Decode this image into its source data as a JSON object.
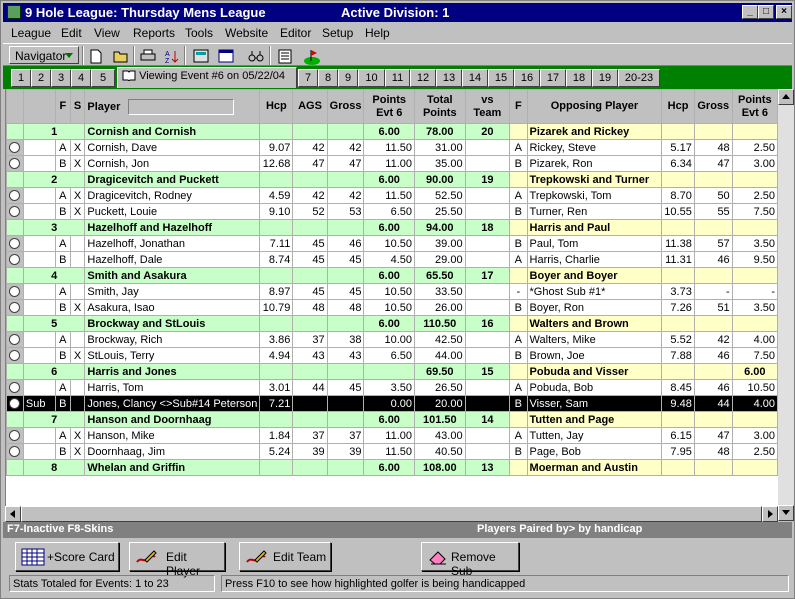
{
  "window": {
    "title": "9 Hole League: Thursday Mens League",
    "division": "Active Division: 1",
    "minimize_glyph": "_",
    "maximize_glyph": "□",
    "close_glyph": "×"
  },
  "menu": [
    "League",
    "Edit",
    "View",
    "Reports",
    "Tools",
    "Website",
    "Editor",
    "Setup",
    "Help"
  ],
  "toolbar": {
    "navigator_label": "Navigator"
  },
  "tabs": {
    "before": [
      "1",
      "2",
      "3",
      "4",
      "5"
    ],
    "active": "Viewing Event #6 on 05/22/04",
    "after": [
      "7",
      "8",
      "9",
      "10",
      "11",
      "12",
      "13",
      "14",
      "15",
      "16",
      "17",
      "18",
      "19",
      "20-23"
    ]
  },
  "grid": {
    "headers": {
      "f": "F",
      "s": "S",
      "player": "Player",
      "hcp": "Hcp",
      "ags": "AGS",
      "gross": "Gross",
      "points_evt_1": "Points",
      "points_evt_2": "Evt 6",
      "total_1": "Total",
      "total_2": "Points",
      "vs_1": "vs",
      "vs_2": "Team",
      "f2": "F",
      "opp_player": "Opposing Player",
      "opp_hcp": "Hcp",
      "opp_gross": "Gross",
      "opp_points_1": "Points",
      "opp_points_2": "Evt 6"
    },
    "teams": [
      {
        "num": "1",
        "name": "Cornish and Cornish",
        "points": "6.00",
        "total": "78.00",
        "vs": "20",
        "opp_name": "Pizarek and Rickey",
        "opp_points": "",
        "players": [
          {
            "sub": "",
            "f": "A",
            "s": "X",
            "name": "Cornish, Dave",
            "hcp": "9.07",
            "ags": "42",
            "gross": "42",
            "pts": "11.50",
            "tot": "31.00",
            "of": "A",
            "oname": "Rickey, Steve",
            "ohcp": "5.17",
            "ogross": "48",
            "opts": "2.50"
          },
          {
            "sub": "",
            "f": "B",
            "s": "X",
            "name": "Cornish, Jon",
            "hcp": "12.68",
            "ags": "47",
            "gross": "47",
            "pts": "11.00",
            "tot": "35.00",
            "of": "B",
            "oname": "Pizarek, Ron",
            "ohcp": "6.34",
            "ogross": "47",
            "opts": "3.00"
          }
        ]
      },
      {
        "num": "2",
        "name": "Dragicevitch and Puckett",
        "points": "6.00",
        "total": "90.00",
        "vs": "19",
        "opp_name": "Trepkowski and Turner",
        "opp_points": "",
        "players": [
          {
            "sub": "",
            "f": "A",
            "s": "X",
            "name": "Dragicevitch, Rodney",
            "hcp": "4.59",
            "ags": "42",
            "gross": "42",
            "pts": "11.50",
            "tot": "52.50",
            "of": "A",
            "oname": "Trepkowski, Tom",
            "ohcp": "8.70",
            "ogross": "50",
            "opts": "2.50"
          },
          {
            "sub": "",
            "f": "B",
            "s": "X",
            "name": "Puckett, Louie",
            "hcp": "9.10",
            "ags": "52",
            "gross": "53",
            "pts": "6.50",
            "tot": "25.50",
            "of": "B",
            "oname": "Turner, Ren",
            "ohcp": "10.55",
            "ogross": "55",
            "opts": "7.50"
          }
        ]
      },
      {
        "num": "3",
        "name": "Hazelhoff and Hazelhoff",
        "points": "6.00",
        "total": "94.00",
        "vs": "18",
        "opp_name": "Harris and Paul",
        "opp_points": "",
        "players": [
          {
            "sub": "",
            "f": "A",
            "s": "",
            "name": "Hazelhoff, Jonathan",
            "hcp": "7.11",
            "ags": "45",
            "gross": "46",
            "pts": "10.50",
            "tot": "39.00",
            "of": "B",
            "oname": "Paul, Tom",
            "ohcp": "11.38",
            "ogross": "57",
            "opts": "3.50"
          },
          {
            "sub": "",
            "f": "B",
            "s": "",
            "name": "Hazelhoff, Dale",
            "hcp": "8.74",
            "ags": "45",
            "gross": "45",
            "pts": "4.50",
            "tot": "29.00",
            "of": "A",
            "oname": "Harris, Charlie",
            "ohcp": "11.31",
            "ogross": "46",
            "opts": "9.50"
          }
        ]
      },
      {
        "num": "4",
        "name": "Smith and Asakura",
        "points": "6.00",
        "total": "65.50",
        "vs": "17",
        "opp_name": "Boyer and Boyer",
        "opp_points": "",
        "players": [
          {
            "sub": "",
            "f": "A",
            "s": "",
            "name": "Smith, Jay",
            "hcp": "8.97",
            "ags": "45",
            "gross": "45",
            "pts": "10.50",
            "tot": "33.50",
            "of": "-",
            "oname": "*Ghost Sub #1*",
            "ohcp": "3.73",
            "ogross": "-",
            "opts": "-"
          },
          {
            "sub": "",
            "f": "B",
            "s": "X",
            "name": "Asakura, Isao",
            "hcp": "10.79",
            "ags": "48",
            "gross": "48",
            "pts": "10.50",
            "tot": "26.00",
            "of": "B",
            "oname": "Boyer, Ron",
            "ohcp": "7.26",
            "ogross": "51",
            "opts": "3.50"
          }
        ]
      },
      {
        "num": "5",
        "name": "Brockway and StLouis",
        "points": "6.00",
        "total": "110.50",
        "vs": "16",
        "opp_name": "Walters and Brown",
        "opp_points": "",
        "players": [
          {
            "sub": "",
            "f": "A",
            "s": "",
            "name": "Brockway, Rich",
            "hcp": "3.86",
            "ags": "37",
            "gross": "38",
            "pts": "10.00",
            "tot": "42.50",
            "of": "A",
            "oname": "Walters, Mike",
            "ohcp": "5.52",
            "ogross": "42",
            "opts": "4.00"
          },
          {
            "sub": "",
            "f": "B",
            "s": "X",
            "name": "StLouis, Terry",
            "hcp": "4.94",
            "ags": "43",
            "gross": "43",
            "pts": "6.50",
            "tot": "44.00",
            "of": "B",
            "oname": "Brown, Joe",
            "ohcp": "7.88",
            "ogross": "46",
            "opts": "7.50"
          }
        ]
      },
      {
        "num": "6",
        "name": "Harris and Jones",
        "points": "",
        "total": "69.50",
        "vs": "15",
        "opp_name": "Pobuda and Visser",
        "opp_points": "6.00",
        "players": [
          {
            "sub": "",
            "f": "A",
            "s": "",
            "name": "Harris, Tom",
            "hcp": "3.01",
            "ags": "44",
            "gross": "45",
            "pts": "3.50",
            "tot": "26.50",
            "of": "A",
            "oname": "Pobuda, Bob",
            "ohcp": "8.45",
            "ogross": "46",
            "opts": "10.50"
          },
          {
            "sub": "Sub",
            "f": "B",
            "s": "",
            "name": "Jones, Clancy <>Sub#14 Peterson",
            "hcp": "7.21",
            "ags": "",
            "gross": "",
            "pts": "0.00",
            "tot": "20.00",
            "of": "B",
            "oname": "Visser, Sam",
            "ohcp": "9.48",
            "ogross": "44",
            "opts": "4.00",
            "selected": true
          }
        ]
      },
      {
        "num": "7",
        "name": "Hanson and Doornhaag",
        "points": "6.00",
        "total": "101.50",
        "vs": "14",
        "opp_name": "Tutten and Page",
        "opp_points": "",
        "players": [
          {
            "sub": "",
            "f": "A",
            "s": "X",
            "name": "Hanson, Mike",
            "hcp": "1.84",
            "ags": "37",
            "gross": "37",
            "pts": "11.00",
            "tot": "43.00",
            "of": "A",
            "oname": "Tutten, Jay",
            "ohcp": "6.15",
            "ogross": "47",
            "opts": "3.00"
          },
          {
            "sub": "",
            "f": "B",
            "s": "X",
            "name": "Doornhaag, Jim",
            "hcp": "5.24",
            "ags": "39",
            "gross": "39",
            "pts": "11.50",
            "tot": "40.50",
            "of": "B",
            "oname": "Page, Bob",
            "ohcp": "7.95",
            "ogross": "48",
            "opts": "2.50"
          }
        ]
      },
      {
        "num": "8",
        "name": "Whelan and Griffin",
        "points": "6.00",
        "total": "108.00",
        "vs": "13",
        "opp_name": "Moerman and Austin",
        "opp_points": "",
        "players": []
      }
    ]
  },
  "status_bar_top": {
    "left": "F7-Inactive  F8-Skins",
    "right": "Players Paired by> by handicap"
  },
  "buttons": {
    "score_card": "+Score Card",
    "edit_player": "Edit Player",
    "edit_team": "Edit Team",
    "remove_sub": "Remove Sub"
  },
  "status_bar": {
    "stats": "Stats Totaled for Events: 1 to 23",
    "hint": "Press F10 to see how highlighted golfer is being handicapped"
  },
  "colors": {
    "team_row": "#c8ffc8",
    "opp_team_row": "#ffffc8",
    "title_bar": "#000080",
    "tab_strip": "#008000",
    "selected_row": "#000000"
  }
}
